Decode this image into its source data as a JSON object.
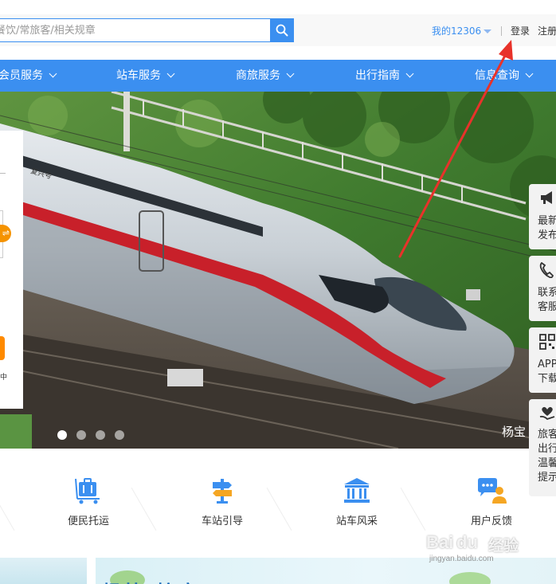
{
  "header": {
    "search_placeholder": "餐饮/常旅客/相关规章",
    "my_account": "我的12306",
    "login": "登录",
    "register": "注册"
  },
  "nav": {
    "items": [
      {
        "label": "会员服务"
      },
      {
        "label": "站车服务"
      },
      {
        "label": "商旅服务"
      },
      {
        "label": "出行指南"
      },
      {
        "label": "信息查询"
      }
    ]
  },
  "hero": {
    "caption": "杨宝",
    "swap_glyph": "⇌",
    "panel_fragment": "中",
    "train_marking": "复兴号",
    "slides": 4,
    "active_slide": 1
  },
  "sidebar": {
    "items": [
      {
        "icon": "megaphone-icon",
        "line1": "最新",
        "line2": "发布"
      },
      {
        "icon": "phone-icon",
        "line1": "联系",
        "line2": "客服"
      },
      {
        "icon": "qrcode-icon",
        "line1": "APP",
        "line2": "下载"
      },
      {
        "icon": "heart-hand-icon",
        "line1": "旅客",
        "line2": "出行",
        "line3": "温馨",
        "line4": "提示"
      }
    ]
  },
  "services": {
    "items": [
      {
        "icon": "luggage-cart-icon",
        "label": "便民托运"
      },
      {
        "icon": "signpost-icon",
        "label": "车站引导"
      },
      {
        "icon": "station-building-icon",
        "label": "站车风采"
      },
      {
        "icon": "chat-user-icon",
        "label": "用户反馈"
      }
    ]
  },
  "bottom": {
    "title": "畅快 惊享"
  },
  "watermark": {
    "brand": "Bai",
    "paw": "du",
    "cn": "经验",
    "url": "jingyan.baidu.com"
  },
  "colors": {
    "brand_blue": "#3b8ff0",
    "accent_orange": "#f59300",
    "annotation_red": "#e8322a"
  }
}
